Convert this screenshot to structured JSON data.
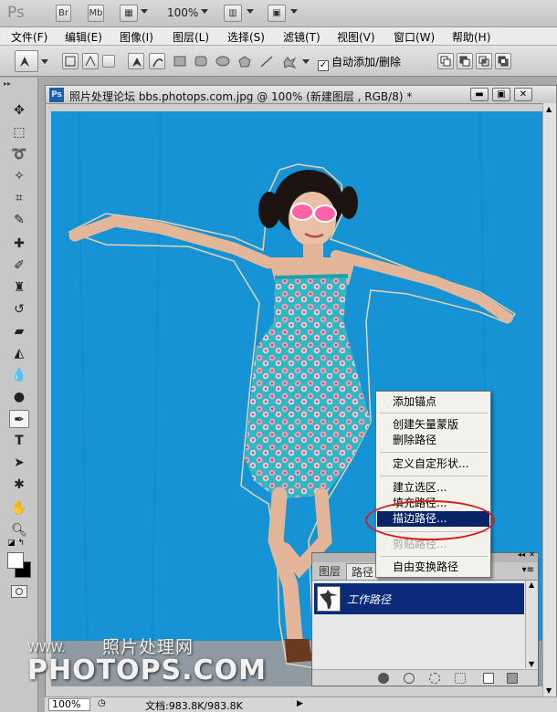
{
  "app": {
    "logo": "Ps",
    "bridge": "Br",
    "minibridge": "Mb",
    "zoom": "100%"
  },
  "menu": [
    "文件(F)",
    "编辑(E)",
    "图像(I)",
    "图层(L)",
    "选择(S)",
    "滤镜(T)",
    "视图(V)",
    "窗口(W)",
    "帮助(H)"
  ],
  "options": {
    "auto_add_delete": "自动添加/删除",
    "auto_add_checked": true
  },
  "document": {
    "title": "照片处理论坛 bbs.photops.com.jpg @ 100% (新建图层 , RGB/8) *",
    "zoom": "100%",
    "doc_info": "文档:983.8K/983.8K"
  },
  "panel": {
    "tabs": [
      "图层",
      "路径"
    ],
    "active_tab": "路径",
    "path_name": "工作路径"
  },
  "context_menu": {
    "items": [
      "添加锚点",
      "创建矢量蒙版",
      "删除路径",
      "定义自定形状...",
      "建立选区...",
      "填充路径...",
      "描边路径...",
      "剪贴路径...",
      "自由变换路径"
    ],
    "selected": "描边路径...",
    "disabled": [
      "剪贴路径..."
    ]
  },
  "watermark": {
    "cn": "照片处理网",
    "www": "WWW.",
    "brand": "PHOTOPS.COM"
  },
  "colors": {
    "canvas_bg": "#1593d4",
    "menu_highlight": "#0a246a",
    "annotation": "#d61b1b"
  }
}
